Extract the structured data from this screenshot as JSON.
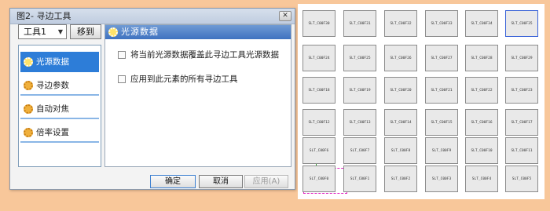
{
  "dialog": {
    "title": "图2- 寻边工具",
    "close_label": "✕",
    "tool_select": {
      "value": "工具1",
      "arrow": "▼"
    },
    "move_button": "移到",
    "nav_items": [
      {
        "label": "光源数据",
        "active": true
      },
      {
        "label": "寻边参数",
        "active": false
      },
      {
        "label": "自动对焦",
        "active": false
      },
      {
        "label": "倍率设置",
        "active": false
      }
    ],
    "panel": {
      "header": "光源数据",
      "options": [
        "将当前光源数据覆盖此寻边工具光源数据",
        "应用到此元素的所有寻边工具"
      ]
    },
    "buttons": {
      "ok": "确定",
      "cancel": "取消",
      "apply": "应用(A)"
    }
  },
  "canvas": {
    "rows": [
      [
        "SLT_C00F30",
        "SLT_C00F31",
        "SLT_C00F32",
        "SLT_C00F33",
        "SLT_C00F34",
        "SLT_C00F35"
      ],
      [
        "SLT_C00F24",
        "SLT_C00F25",
        "SLT_C00F26",
        "SLT_C00F27",
        "SLT_C00F28",
        "SLT_C00F29"
      ],
      [
        "SLT_C00F18",
        "SLT_C00F19",
        "SLT_C00F20",
        "SLT_C00F21",
        "SLT_C00F22",
        "SLT_C00F23"
      ],
      [
        "SLT_C00F12",
        "SLT_C00F13",
        "SLT_C00F14",
        "SLT_C00F15",
        "SLT_C00F16",
        "SLT_C00F17"
      ],
      [
        "SLT_C00F6",
        "SLT_C00F7",
        "SLT_C00F8",
        "SLT_C00F9",
        "SLT_C00F10",
        "SLT_C00F11"
      ],
      [
        "SLT_C00F0",
        "SLT_C00F1",
        "SLT_C00F2",
        "SLT_C00F3",
        "SLT_C00F4",
        "SLT_C00F5"
      ]
    ],
    "selected_slot": "SLT_C00F35"
  }
}
